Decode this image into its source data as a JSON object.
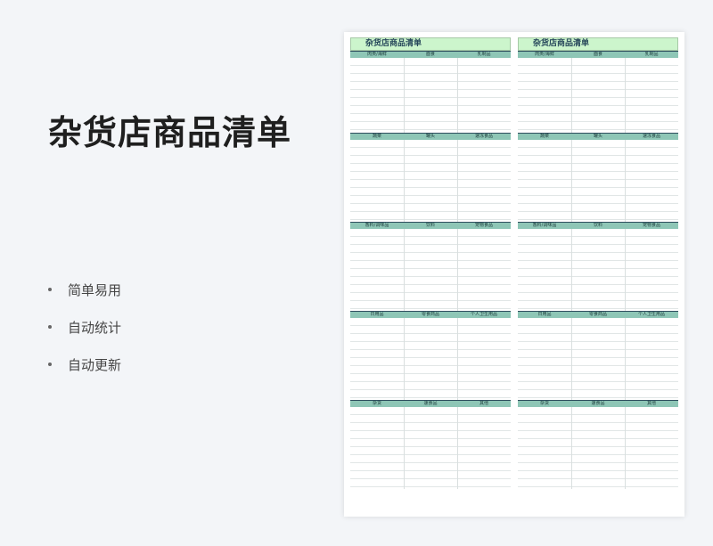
{
  "title": "杂货店商品清单",
  "features": [
    "简单易用",
    "自动统计",
    "自动更新"
  ],
  "sheet": {
    "columns": [
      {
        "title": "杂货店商品清单"
      },
      {
        "title": "杂货店商品清单"
      }
    ],
    "sections": [
      [
        "肉类/海鲜",
        "面食",
        "乳制品"
      ],
      [
        "蔬菜",
        "罐头",
        "速冻食品"
      ],
      [
        "香料/调味品",
        "饮料",
        "宠物食品"
      ],
      [
        "日用品",
        "零食商品",
        "个人卫生用品"
      ],
      [
        "杂货",
        "速食品",
        "其他"
      ]
    ]
  },
  "colors": {
    "title_bar": "#ccf5cc",
    "section_header": "#8ec6b6",
    "background": "#f3f5f8"
  }
}
